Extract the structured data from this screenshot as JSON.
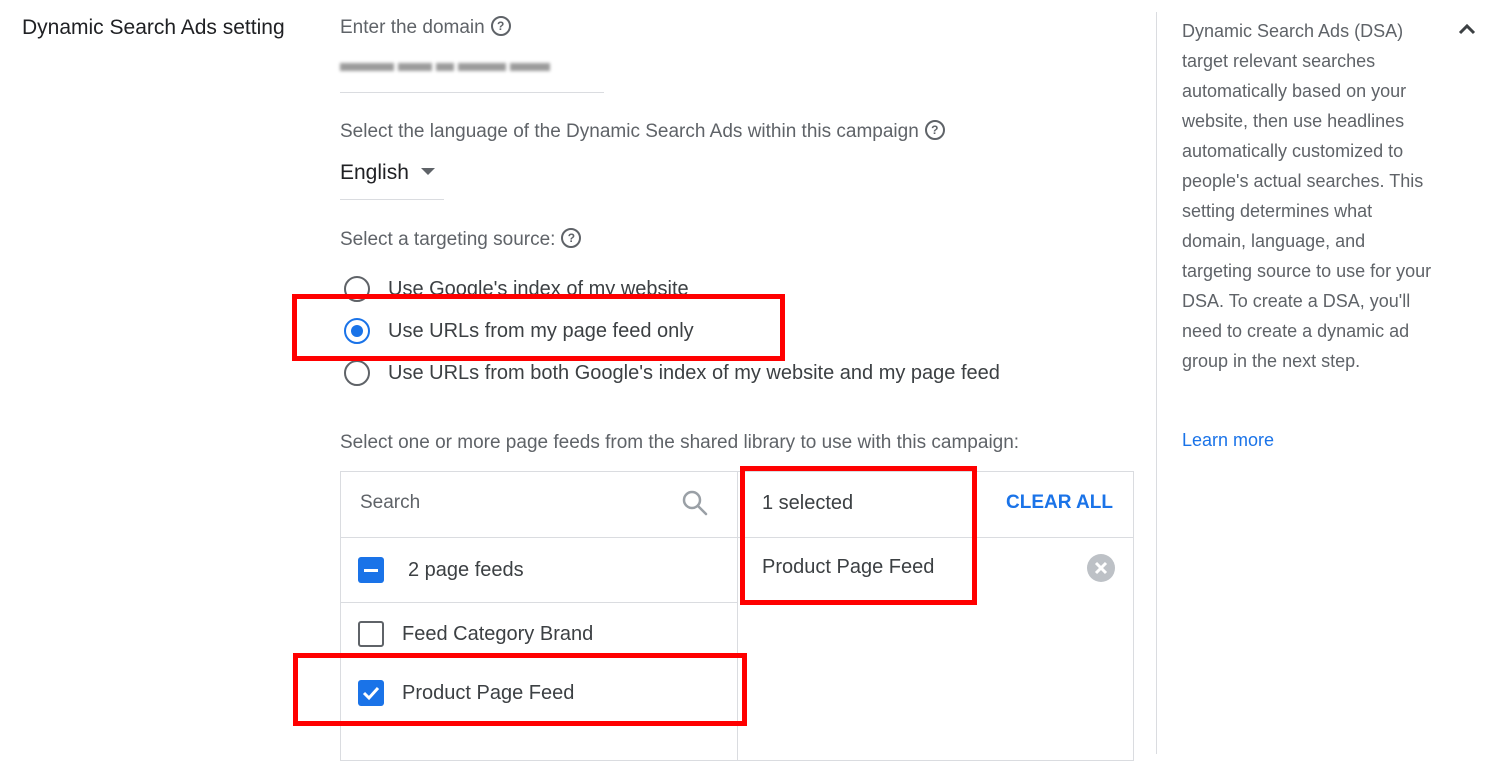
{
  "section_title": "Dynamic Search Ads setting",
  "domain": {
    "label": "Enter the domain",
    "help_icon": "help-circle-icon"
  },
  "language": {
    "label": "Select the language of the Dynamic Search Ads within this campaign",
    "selected": "English"
  },
  "targeting": {
    "label": "Select a targeting source:",
    "options": [
      {
        "label": "Use Google's index of my website",
        "selected": false
      },
      {
        "label": "Use URLs from my page feed only",
        "selected": true
      },
      {
        "label": "Use URLs from both Google's index of my website and my page feed",
        "selected": false
      }
    ]
  },
  "page_feeds": {
    "label": "Select one or more page feeds from the shared library to use with this campaign:",
    "search_placeholder": "Search",
    "group_label": "2 page feeds",
    "items": [
      {
        "label": "Feed Category Brand",
        "checked": false
      },
      {
        "label": "Product Page Feed",
        "checked": true
      }
    ],
    "selected_count": "1 selected",
    "clear_all": "CLEAR ALL",
    "selected_items": [
      "Product Page Feed"
    ]
  },
  "sidebar": {
    "description": "Dynamic Search Ads (DSA) target relevant searches automatically based on your website, then use headlines automatically customized to people's actual searches. This setting determines what domain, language, and targeting source to use for your DSA. To create a DSA, you'll need to create a dynamic ad group in the next step.",
    "learn_more": "Learn more"
  },
  "colors": {
    "accent": "#1a73e8",
    "highlight": "#ff0000"
  }
}
